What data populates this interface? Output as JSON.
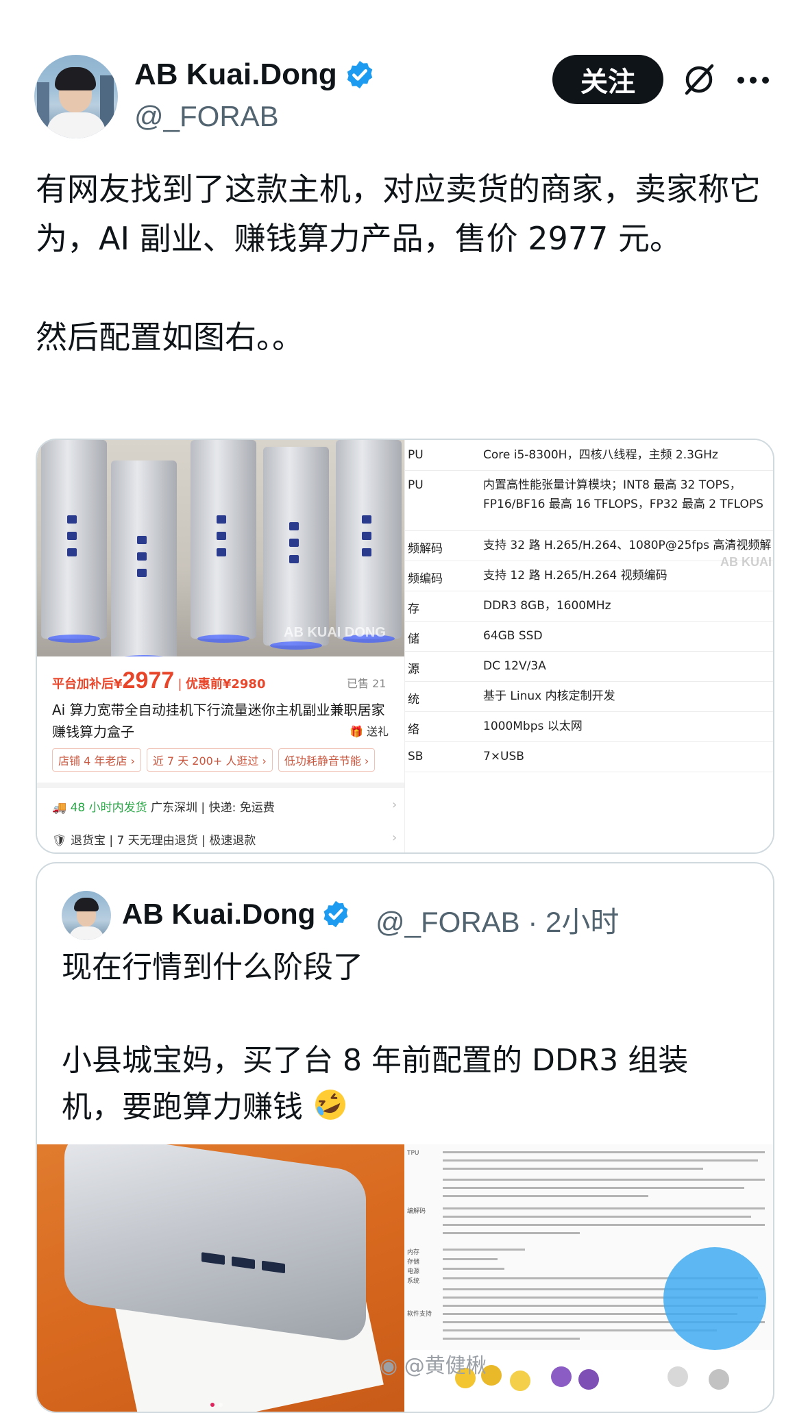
{
  "header": {
    "display_name": "AB Kuai.Dong",
    "handle": "@_FORAB",
    "follow_label": "关注"
  },
  "post": {
    "text": "有网友找到了这款主机，对应卖货的商家，卖家称它为，AI 副业、赚钱算力产品，售价 2977 元。\n\n然后配置如图右。。"
  },
  "listing": {
    "watermark": "AB KUAI DONG",
    "price_label": "平台加补后¥",
    "price": "2977",
    "price_sep": "|",
    "discount_label": "优惠前¥2980",
    "sold": "已售 21",
    "title": "Ai 算力宽带全自动挂机下行流量迷你主机副业兼职居家赚钱算力盒子",
    "gift": "送礼",
    "tags": [
      "店铺 4 年老店 ›",
      "近 7 天 200+ 人逛过 ›",
      "低功耗静音节能 ›"
    ],
    "shipping_fast": "48 小时内发货",
    "shipping_rest": "广东深圳 | 快递: 免运费",
    "returns": "退货宝 | 7 天无理由退货 | 极速退款"
  },
  "specs": {
    "watermark": "AB KUAI DON",
    "rows": [
      {
        "key": "PU",
        "value": "Core i5-8300H，四核八线程，主频 2.3GHz"
      },
      {
        "key": "PU",
        "value": "内置高性能张量计算模块；INT8 最高 32 TOPS，FP16/BF16 最高 16 TFLOPS，FP32 最高 2 TFLOPS"
      },
      {
        "key": "频解码",
        "value": "支持 32 路 H.265/H.264、1080P@25fps 高清视频解"
      },
      {
        "key": "频编码",
        "value": "支持 12 路 H.265/H.264 视频编码"
      },
      {
        "key": "存",
        "value": "DDR3 8GB，1600MHz"
      },
      {
        "key": "储",
        "value": "64GB SSD"
      },
      {
        "key": "源",
        "value": "DC 12V/3A"
      },
      {
        "key": "统",
        "value": "基于 Linux 内核定制开发"
      },
      {
        "key": "络",
        "value": "1000Mbps 以太网"
      },
      {
        "key": "SB",
        "value": "7×USB"
      }
    ]
  },
  "quote": {
    "display_name": "AB Kuai.Dong",
    "meta": "@_FORAB · 2小时",
    "text": "现在行情到什么阶段了\n\n小县城宝妈，买了台 8 年前配置的 DDR3 组装机，要跑算力赚钱",
    "emoji": "rolling-on-floor-laughing",
    "weibo_watermark": "@黄健楸",
    "spec_labels": [
      "TPU",
      "编解码",
      "内存",
      "存储",
      "电源",
      "系统",
      "软件支持"
    ]
  },
  "colors": {
    "brand_verified": "#1d9bf0",
    "price_red": "#e8462b",
    "text_primary": "#0f1419",
    "text_secondary": "#536471"
  }
}
